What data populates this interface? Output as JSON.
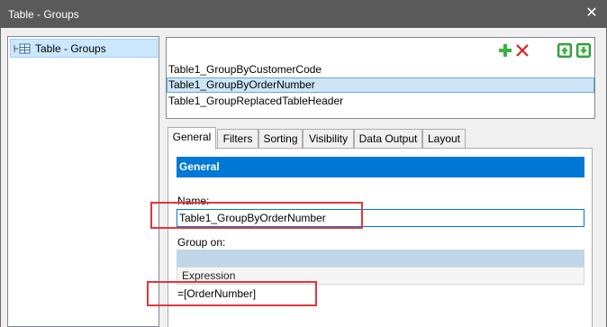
{
  "window": {
    "title": "Table - Groups",
    "close_glyph": "✕"
  },
  "tree": {
    "items": [
      {
        "label": "Table - Groups",
        "icon": "table-icon",
        "selected": true
      }
    ]
  },
  "groups": {
    "toolbar": {
      "add_icon": "plus-icon",
      "delete_icon": "delete-x-icon",
      "move_up_icon": "move-up-icon",
      "move_down_icon": "move-down-icon"
    },
    "items": [
      {
        "label": "Table1_GroupByCustomerCode",
        "selected": false
      },
      {
        "label": "Table1_GroupByOrderNumber",
        "selected": true
      },
      {
        "label": "Table1_GroupReplacedTableHeader",
        "selected": false
      }
    ]
  },
  "tabs": [
    {
      "label": "General",
      "active": true
    },
    {
      "label": "Filters",
      "active": false
    },
    {
      "label": "Sorting",
      "active": false
    },
    {
      "label": "Visibility",
      "active": false
    },
    {
      "label": "Data Output",
      "active": false
    },
    {
      "label": "Layout",
      "active": false
    }
  ],
  "general": {
    "section_title": "General",
    "name_label": "Name:",
    "name_value": "Table1_GroupByOrderNumber",
    "group_on_label": "Group on:",
    "grid": {
      "column_header": "Expression",
      "rows": [
        "=[OrderNumber]"
      ]
    }
  },
  "colors": {
    "titlebar": "#5a5a5a",
    "accent": "#0078d7",
    "selection": "#cde6f7",
    "highlight_box": "#e0383a",
    "add_green": "#3cb043",
    "delete_red": "#e02020"
  }
}
